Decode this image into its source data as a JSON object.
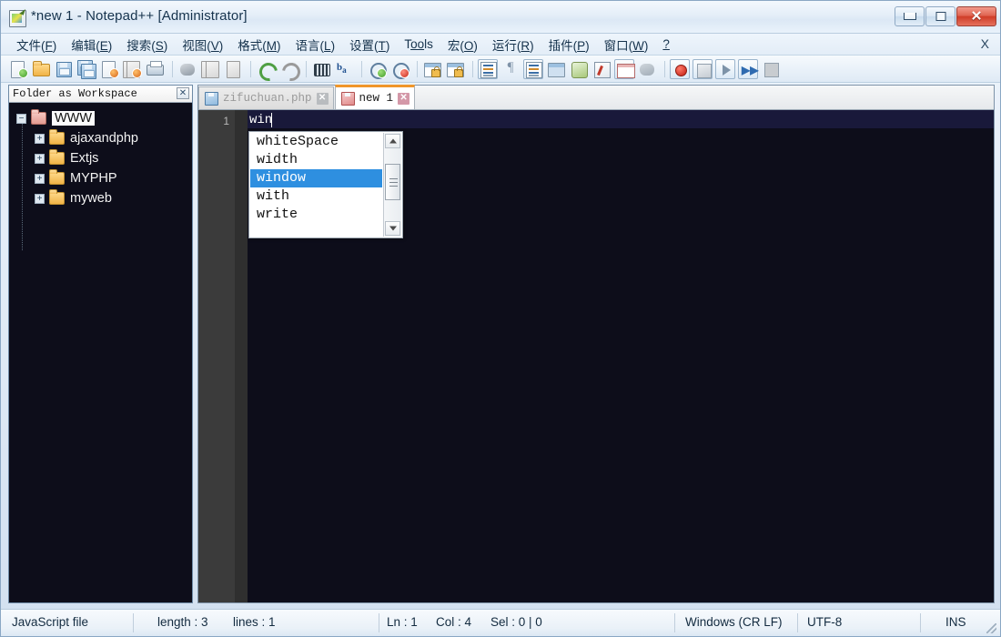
{
  "window": {
    "title": "*new 1 - Notepad++ [Administrator]",
    "icon": "notepad-plus-plus-icon",
    "buttons": {
      "minimize": "minimize-icon",
      "restore": "restore-icon",
      "close": "✕"
    }
  },
  "menu": {
    "items": [
      {
        "label": "文件(F)",
        "pre": "文件(",
        "key": "F",
        "post": ")"
      },
      {
        "label": "编辑(E)",
        "pre": "编辑(",
        "key": "E",
        "post": ")"
      },
      {
        "label": "搜索(S)",
        "pre": "搜索(",
        "key": "S",
        "post": ")"
      },
      {
        "label": "视图(V)",
        "pre": "视图(",
        "key": "V",
        "post": ")"
      },
      {
        "label": "格式(M)",
        "pre": "格式(",
        "key": "M",
        "post": ")"
      },
      {
        "label": "语言(L)",
        "pre": "语言(",
        "key": "L",
        "post": ")"
      },
      {
        "label": "设置(T)",
        "pre": "设置(",
        "key": "T",
        "post": ")"
      },
      {
        "label": "Tools",
        "pre": "T",
        "key": "oo",
        "post": "ls"
      },
      {
        "label": "宏(O)",
        "pre": "宏(",
        "key": "O",
        "post": ")"
      },
      {
        "label": "运行(R)",
        "pre": "运行(",
        "key": "R",
        "post": ")"
      },
      {
        "label": "插件(P)",
        "pre": "插件(",
        "key": "P",
        "post": ")"
      },
      {
        "label": "窗口(W)",
        "pre": "窗口(",
        "key": "W",
        "post": ")"
      },
      {
        "label": "?",
        "pre": "",
        "key": "?",
        "post": ""
      }
    ],
    "close_doc_label": "X"
  },
  "toolbar": {
    "buttons": [
      "new-file-icon",
      "open-file-icon",
      "save-icon",
      "save-all-icon",
      "close-file-icon",
      "close-all-icon",
      "print-icon",
      "cut-icon",
      "copy-icon",
      "paste-icon",
      "undo-icon",
      "redo-icon",
      "find-icon",
      "replace-icon",
      "zoom-in-icon",
      "zoom-out-icon",
      "sync-vertical-scroll-icon",
      "sync-horizontal-scroll-icon",
      "word-wrap-icon",
      "show-all-chars-icon",
      "indent-guide-icon",
      "user-defined-language-icon",
      "show-doc-map-icon",
      "function-list-icon",
      "folder-as-workspace-icon",
      "monitoring-icon",
      "macro-record-icon",
      "macro-stop-icon",
      "macro-play-icon",
      "macro-playback-multiple-icon",
      "macro-save-icon"
    ]
  },
  "workspace": {
    "title": "Folder as Workspace",
    "close_label": "✕",
    "tree": [
      {
        "label": "WWW",
        "expander": "−",
        "icon": "root-folder-icon",
        "selected": true,
        "level": 0
      },
      {
        "label": "ajaxandphp",
        "expander": "+",
        "icon": "folder-icon",
        "selected": false,
        "level": 1
      },
      {
        "label": "Extjs",
        "expander": "+",
        "icon": "folder-icon",
        "selected": false,
        "level": 1
      },
      {
        "label": "MYPHP",
        "expander": "+",
        "icon": "folder-icon",
        "selected": false,
        "level": 1
      },
      {
        "label": "myweb",
        "expander": "+",
        "icon": "folder-icon",
        "selected": false,
        "level": 1
      }
    ]
  },
  "tabs": [
    {
      "label": "zifuchuan.php",
      "active": false,
      "icon": "saved-file-icon",
      "close": "✕"
    },
    {
      "label": "new 1",
      "active": true,
      "icon": "unsaved-file-icon",
      "close": "✕"
    }
  ],
  "editor": {
    "line_number": "1",
    "text": "win",
    "language": "JavaScript"
  },
  "autocomplete": {
    "items": [
      {
        "label": "whiteSpace",
        "selected": false
      },
      {
        "label": "width",
        "selected": false
      },
      {
        "label": "window",
        "selected": true
      },
      {
        "label": "with",
        "selected": false
      },
      {
        "label": "write",
        "selected": false
      }
    ],
    "scrollbar": {
      "up": "scroll-up-arrow-icon",
      "down": "scroll-down-arrow-icon"
    }
  },
  "statusbar": {
    "file_type": "JavaScript file",
    "length": "length : 3",
    "lines": "lines : 1",
    "ln": "Ln : 1",
    "col": "Col : 4",
    "sel": "Sel : 0 | 0",
    "eol": "Windows (CR LF)",
    "encoding": "UTF-8",
    "insert_mode": "INS"
  },
  "colors": {
    "editor_background": "#0d0d1a",
    "current_line": "#19193a",
    "gutter": "#3b3b3b",
    "active_tab_accent": "#f0962a",
    "autocomplete_selection": "#2e8fe0",
    "close_button": "#cf3d28"
  }
}
